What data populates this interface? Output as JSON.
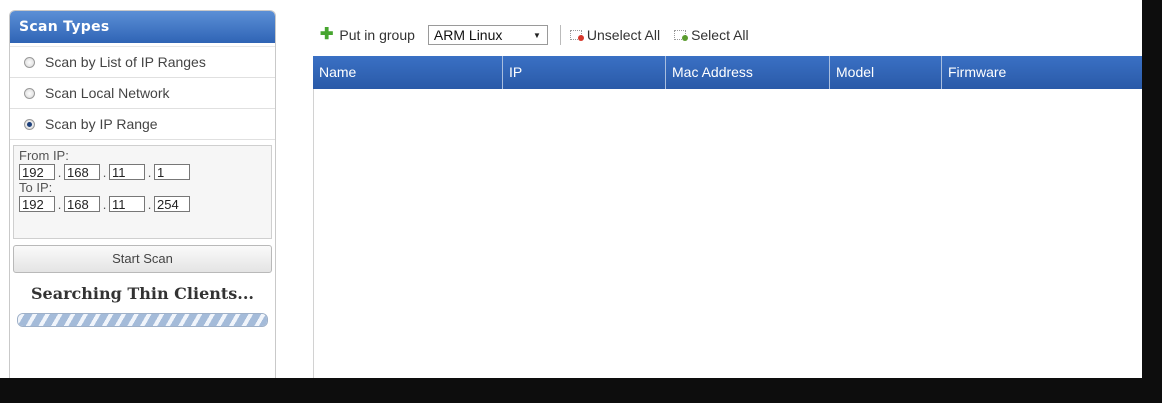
{
  "scan_panel": {
    "title": "Scan Types",
    "options": [
      {
        "label": "Scan by List of IP Ranges",
        "checked": false
      },
      {
        "label": "Scan Local Network",
        "checked": false
      },
      {
        "label": "Scan by IP Range",
        "checked": true
      }
    ],
    "from_ip": {
      "label": "From IP:",
      "octets": [
        "192",
        "168",
        "11",
        "1"
      ]
    },
    "to_ip": {
      "label": "To IP:",
      "octets": [
        "192",
        "168",
        "11",
        "254"
      ]
    },
    "start_button": "Start Scan",
    "status_text": "Searching Thin Clients..."
  },
  "toolbar": {
    "put_in_group": "Put in group",
    "group_value": "ARM Linux",
    "unselect_all": "Unselect All",
    "select_all": "Select All"
  },
  "table": {
    "columns": [
      "Name",
      "IP",
      "Mac Address",
      "Model",
      "Firmware"
    ],
    "rows": []
  },
  "icons": {
    "add": "plus-icon",
    "unselect": "unselect-all-icon",
    "select": "select-all-icon",
    "dropdown": "chevron-down-icon"
  },
  "colors": {
    "header_blue": "#2f64b5",
    "add_green": "#46a52f",
    "unselect_red": "#d7372b",
    "select_green": "#5a9c2e"
  }
}
